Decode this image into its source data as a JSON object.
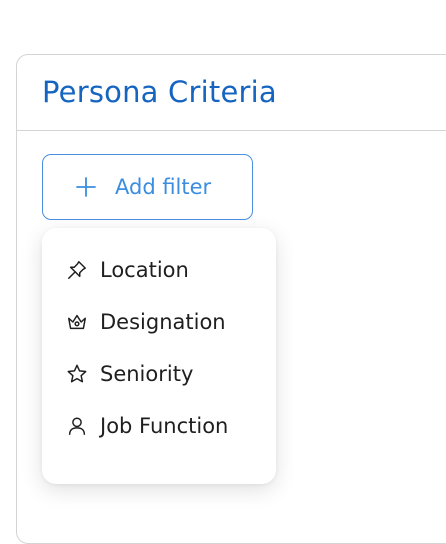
{
  "panel": {
    "title": "Persona Criteria"
  },
  "add_filter": {
    "label": "Add filter",
    "icon": "plus-icon",
    "color": "#3b8de0"
  },
  "menu": {
    "items": [
      {
        "label": "Location",
        "icon": "pin-icon"
      },
      {
        "label": "Designation",
        "icon": "crown-icon"
      },
      {
        "label": "Seniority",
        "icon": "star-icon"
      },
      {
        "label": "Job Function",
        "icon": "user-icon"
      }
    ]
  },
  "colors": {
    "title": "#1565c0",
    "accent": "#4a90e2",
    "border": "#d4d4d4"
  }
}
